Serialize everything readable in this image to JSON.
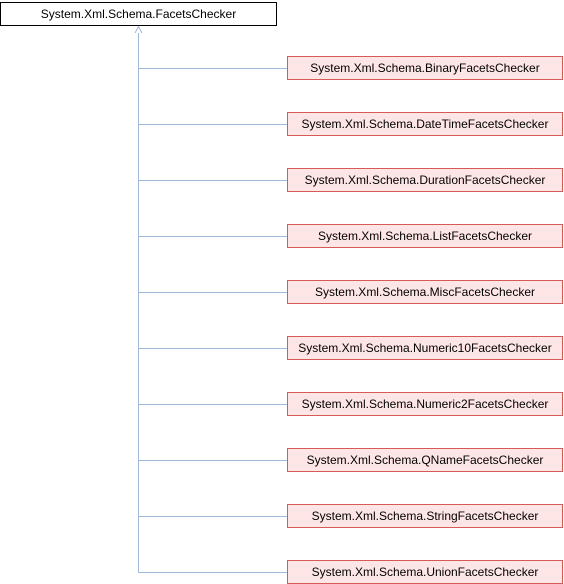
{
  "diagram": {
    "base_class": "System.Xml.Schema.FacetsChecker",
    "derived_classes": [
      "System.Xml.Schema.BinaryFacetsChecker",
      "System.Xml.Schema.DateTimeFacetsChecker",
      "System.Xml.Schema.DurationFacetsChecker",
      "System.Xml.Schema.ListFacetsChecker",
      "System.Xml.Schema.MiscFacetsChecker",
      "System.Xml.Schema.Numeric10FacetsChecker",
      "System.Xml.Schema.Numeric2FacetsChecker",
      "System.Xml.Schema.QNameFacetsChecker",
      "System.Xml.Schema.StringFacetsChecker",
      "System.Xml.Schema.UnionFacetsChecker"
    ],
    "colors": {
      "connector": "#9fb8d8",
      "derived_fill": "#ffe6e6",
      "derived_border": "#d75a5a",
      "base_border": "#000000"
    }
  }
}
